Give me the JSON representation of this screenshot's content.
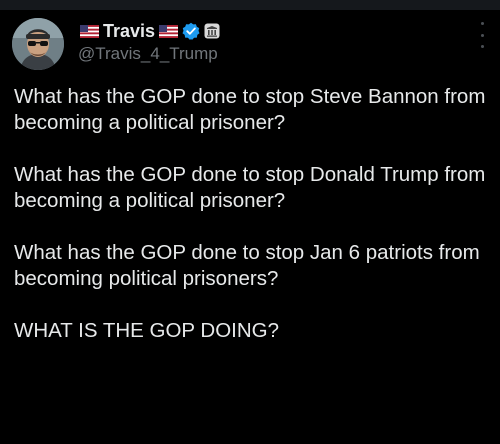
{
  "author": {
    "display_name": "Travis",
    "handle": "@Travis_4_Trump",
    "icons": {
      "left_flag": "us-flag-icon",
      "right_flag": "us-flag-icon",
      "verified": "verified-badge-icon",
      "affiliate": "affiliate-badge-icon"
    }
  },
  "menu": {
    "icon": "more-vertical-icon"
  },
  "tweet": {
    "paragraphs": [
      "What has the GOP done to stop Steve Bannon from becoming a political prisoner?",
      "What has the GOP done to stop Donald Trump from becoming a political prisoner?",
      "What has the GOP done to stop Jan 6 patriots from becoming political prisoners?",
      "WHAT IS THE GOP DOING?"
    ]
  },
  "colors": {
    "background": "#000000",
    "text": "#e7e9ea",
    "handle": "#71767b",
    "verified": "#1d9bf0"
  }
}
